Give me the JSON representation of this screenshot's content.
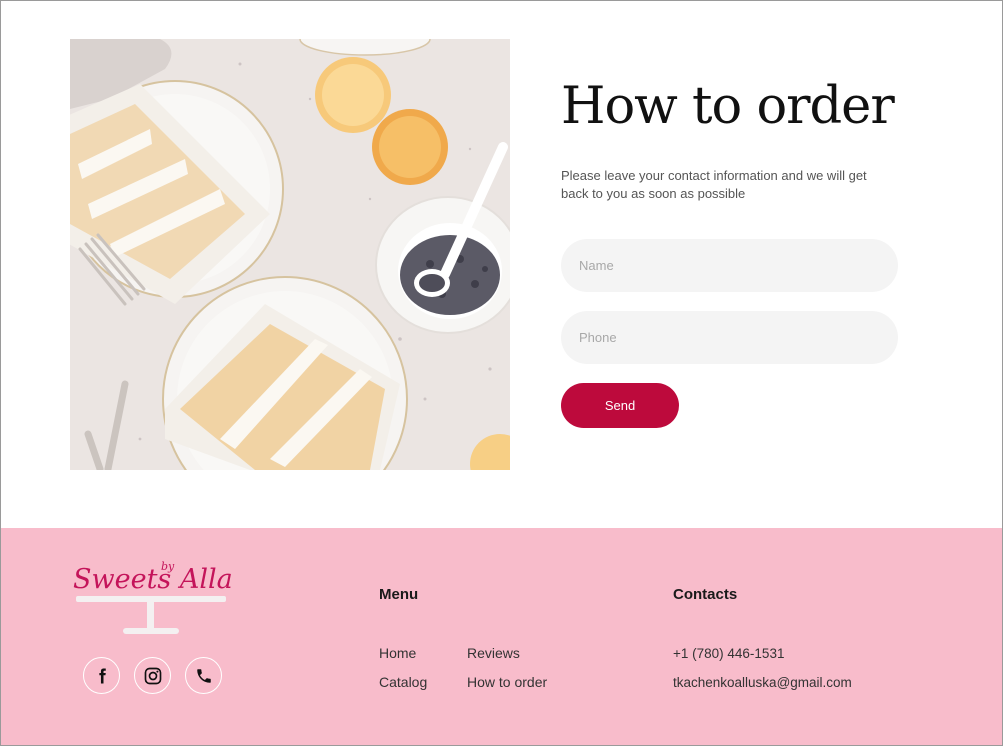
{
  "order": {
    "title": "How to order",
    "subtitle": "Please leave your contact information and we will get back to you as soon as possible",
    "name_placeholder": "Name",
    "phone_placeholder": "Phone",
    "send_label": "Send"
  },
  "footer": {
    "logo": {
      "text": "Sweets Alla",
      "by": "by"
    },
    "socials": [
      {
        "icon": "facebook-icon"
      },
      {
        "icon": "instagram-icon"
      },
      {
        "icon": "phone-icon"
      }
    ],
    "menu": {
      "title": "Menu",
      "items": [
        {
          "label": "Home"
        },
        {
          "label": "Reviews"
        },
        {
          "label": "Catalog"
        },
        {
          "label": "How to order"
        }
      ]
    },
    "contacts": {
      "title": "Contacts",
      "phone": "+1 (780) 446-1531",
      "email": "tkachenkoalluska@gmail.com"
    }
  },
  "colors": {
    "accent": "#bd0a3c",
    "footer_bg": "#f8bccb",
    "input_bg": "#f4f4f4",
    "logo": "#c4145a"
  }
}
